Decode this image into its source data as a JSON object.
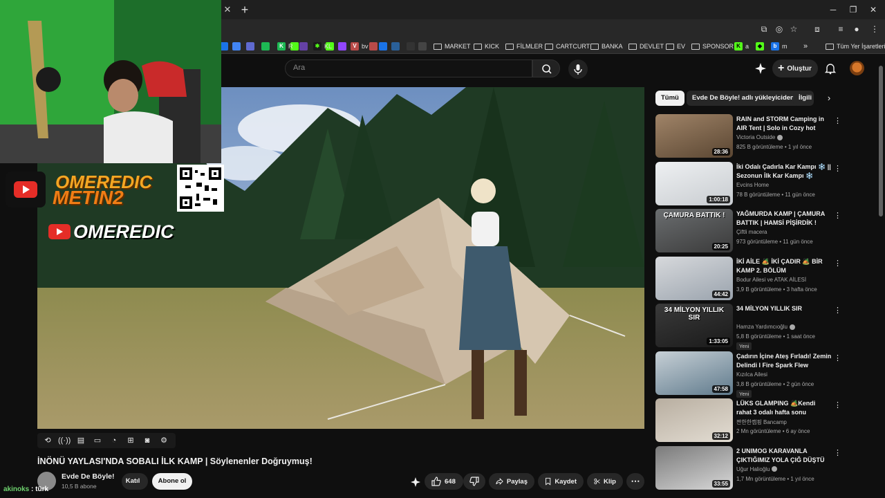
{
  "browser": {
    "bookmarks": [
      {
        "label": "R",
        "icon_color": "#1db954"
      },
      {
        "label": "KL",
        "icon_color": "#53fc18"
      },
      {
        "label": "bv",
        "icon_color": "#b94a48"
      },
      {
        "label": "MARKET"
      },
      {
        "label": "KICK"
      },
      {
        "label": "FİLMLER"
      },
      {
        "label": "CARTCURT"
      },
      {
        "label": "BANKA"
      },
      {
        "label": "DEVLET"
      },
      {
        "label": "EV"
      },
      {
        "label": "SPONSOR"
      },
      {
        "label": "a",
        "icon_color": "#53fc18"
      },
      {
        "label": "m",
        "icon_color": "#1a73e8"
      }
    ],
    "all_bookmarks": "Tüm Yer İşaretleri",
    "overflow": "»"
  },
  "header": {
    "search_placeholder": "Ara",
    "create_label": "Oluştur"
  },
  "video": {
    "title": "İNÖNÜ YAYLASI'NDA SOBALI İLK KAMP | Söylenenler Doğruymuş!",
    "channel": "Evde De Böyle!",
    "subscribers": "10,5 B abone",
    "join_label": "Katıl",
    "subscribe_label": "Abone ol",
    "likes": "648",
    "share_label": "Paylaş",
    "save_label": "Kaydet",
    "clip_label": "Klip"
  },
  "overlay": {
    "brand_line1": "OMEREDIC",
    "brand_line2": "METIN2",
    "channel_tag": "OMEREDIC"
  },
  "chat": {
    "user": "akinoks",
    "separator": " : ",
    "message": "türk"
  },
  "chips": [
    {
      "label": "Tümü",
      "active": true
    },
    {
      "label": "Evde De Böyle! adlı yükleyiciden",
      "active": false
    },
    {
      "label": "İlgili",
      "active": false
    }
  ],
  "recommendations": [
    {
      "title": "RAIN and STORM Camping in AIR Tent | Solo in Cozy hot ten…",
      "channel": "Victoria Outside",
      "verified": true,
      "meta": "825 B görüntüleme • 1 yıl önce",
      "duration": "28:36",
      "badge": ""
    },
    {
      "title": "İki Odalı Çadırla Kar Kampı ❄️ || Sezonun İlk Kar Kampı ❄️",
      "channel": "Evcins Home",
      "verified": false,
      "meta": "78 B görüntüleme • 11 gün önce",
      "duration": "1:00:18",
      "badge": ""
    },
    {
      "title": "YAĞMURDA KAMP | ÇAMURA BATTIK | HAMSİ PİŞİRDİK !",
      "channel": "Çiftli macera",
      "verified": false,
      "meta": "973 görüntüleme • 11 gün önce",
      "duration": "20:25",
      "badge": "",
      "thumb_text": "ÇAMURA BATTIK !"
    },
    {
      "title": "İKİ AİLE 🏕️ İKİ ÇADIR 🏕️ BİR KAMP  2. BÖLÜM",
      "channel": "Bodur Ailesi ve ATAK AİLESİ",
      "verified": false,
      "meta": "3,9 B görüntüleme • 3 hafta önce",
      "duration": "44:42",
      "badge": ""
    },
    {
      "title": "34 MİLYON YILLIK SIR",
      "channel": "Hamza Yardımcıoğlu",
      "verified": true,
      "meta": "5,8 B görüntüleme • 1 saat önce",
      "duration": "1:33:05",
      "badge": "Yeni",
      "thumb_text": "34 MİLYON YILLIK SIR"
    },
    {
      "title": "Çadırın İçine Ateş Fırladı! Zemin Delindi I Fire Spark Flew Inside…",
      "channel": "Kızılca Ailesi",
      "verified": false,
      "meta": "3,8 B görüntüleme • 2 gün önce",
      "duration": "47:58",
      "badge": "Yeni"
    },
    {
      "title": "LÜKS GLAMPING 🏕️Kendi rahat 3 odalı hafta sonu villamda bir …",
      "channel": "짠한한캠핑 Bancamp",
      "verified": false,
      "meta": "2 Mn görüntüleme • 6 ay önce",
      "duration": "32:12",
      "badge": ""
    },
    {
      "title": "2 UNIMOG KARAVANLA ÇIKTIĞIMIZ YOLA ÇIĞ DÜŞTÜ",
      "channel": "Uğur Halioğlu",
      "verified": true,
      "meta": "1,7 Mn görüntüleme • 1 yıl önce",
      "duration": "33:55",
      "badge": ""
    }
  ],
  "colors": {
    "background": "#0f0f0f",
    "chip_bg": "#272727",
    "text": "#f1f1f1",
    "secondary_text": "#aaaaaa",
    "accent_green": "#53fc18"
  },
  "icons": [
    "search-icon",
    "mic-icon",
    "create-icon",
    "bell-icon",
    "like-icon",
    "dislike-icon",
    "share-icon",
    "save-icon",
    "clip-icon",
    "more-icon"
  ]
}
